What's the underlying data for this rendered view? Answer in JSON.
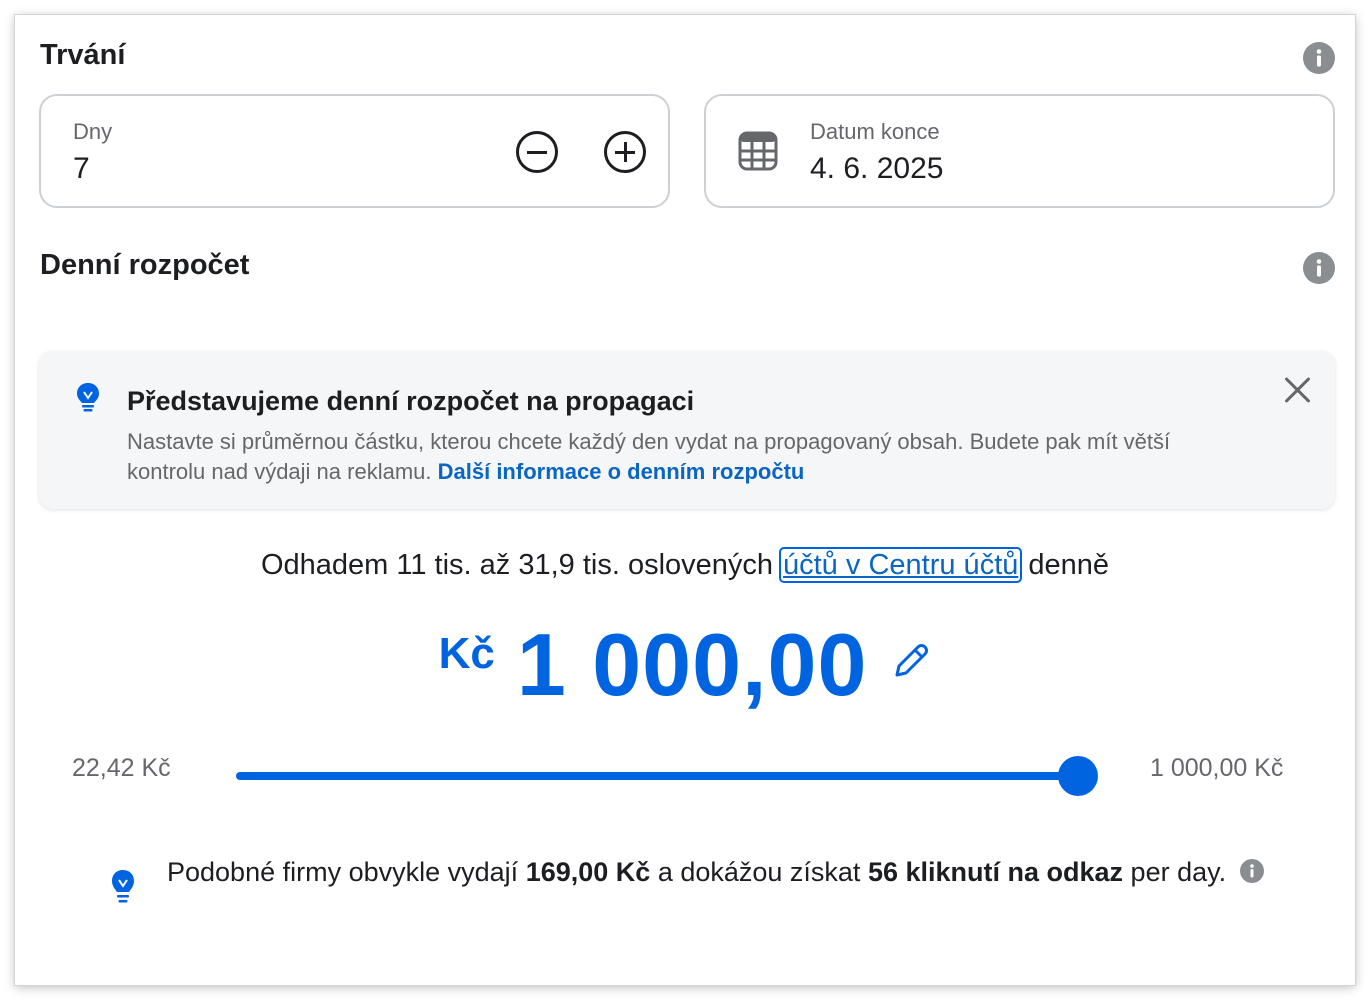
{
  "duration": {
    "title": "Trvání",
    "days_label": "Dny",
    "days_value": "7",
    "end_date_label": "Datum konce",
    "end_date_value": "4. 6. 2025"
  },
  "budget": {
    "title": "Denní rozpočet",
    "banner": {
      "title": "Představujeme denní rozpočet na propagaci",
      "text": "Nastavte si průměrnou částku, kterou chcete každý den vydat na propagovaný obsah. Budete pak mít větší kontrolu nad výdaji na reklamu.",
      "link": "Další informace o denním rozpočtu"
    },
    "estimate_prefix": "Odhadem 11 tis. až 31,9 tis. oslovených",
    "estimate_link": "účtů v Centru účtů",
    "estimate_suffix": "denně",
    "currency": "Kč",
    "amount": "1 000,00",
    "slider_min": "22,42 Kč",
    "slider_max": "1 000,00 Kč",
    "slider_fraction": 1.0,
    "tip": {
      "part1": "Podobné firmy obvykle vydají",
      "amount": "169,00 Kč",
      "part2": "a dokážou získat",
      "clicks": "56 kliknutí na odkaz",
      "part3": "per day."
    }
  },
  "colors": {
    "accent": "#0064e0",
    "link": "#0a66c2",
    "muted_text": "#65676b",
    "border": "#ccd0d5"
  },
  "icons": [
    "info-icon",
    "minus-circle-icon",
    "plus-circle-icon",
    "calendar-icon",
    "lightbulb-icon",
    "close-icon",
    "pencil-icon"
  ]
}
